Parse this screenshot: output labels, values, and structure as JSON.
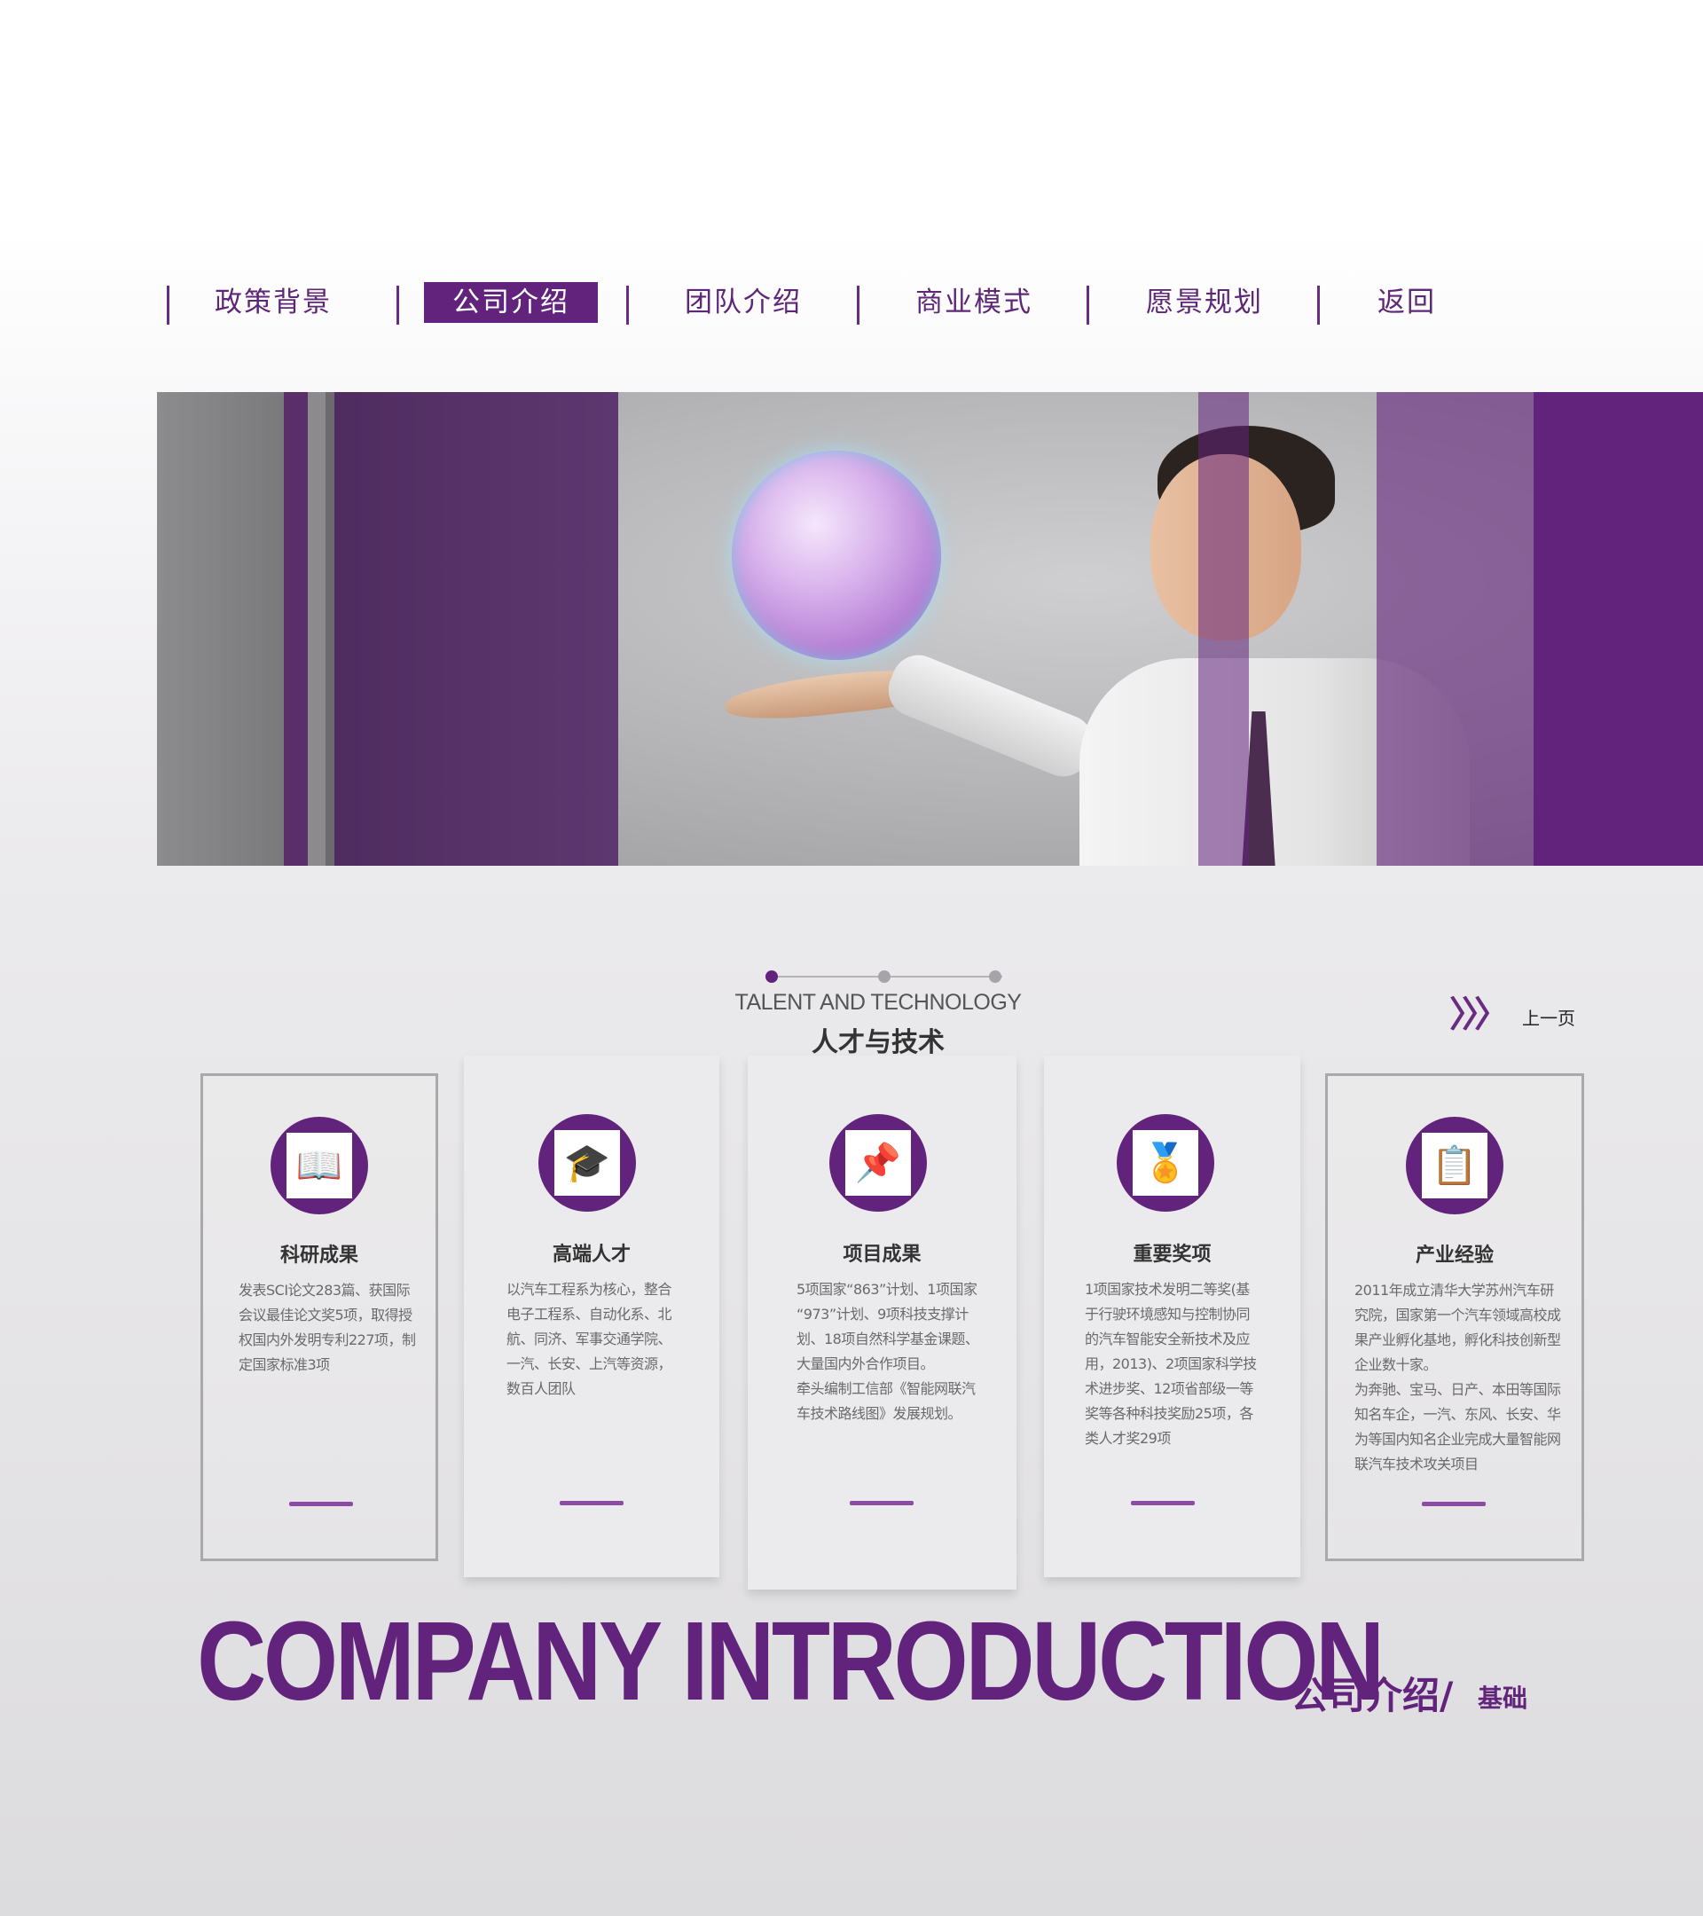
{
  "nav": {
    "items": [
      {
        "label": "政策背景",
        "active": false
      },
      {
        "label": "公司介绍",
        "active": true
      },
      {
        "label": "团队介绍",
        "active": false
      },
      {
        "label": "商业模式",
        "active": false
      },
      {
        "label": "愿景规划",
        "active": false
      },
      {
        "label": "返回",
        "active": false
      }
    ]
  },
  "section": {
    "title_en": "TALENT AND TECHNOLOGY",
    "title_cn": "人才与技术",
    "prev_label": "上一页",
    "prev_icon": "triple-chevron-right-icon"
  },
  "cards": [
    {
      "title": "科研成果",
      "icon": "open-book-icon",
      "text": "发表SCI论文283篇、获国际\n会议最佳论文奖5项，取得授\n权国内外发明专利227项，制\n定国家标准3项"
    },
    {
      "title": "高端人才",
      "icon": "graduate-cap-icon",
      "text": "以汽车工程系为核心，整合\n电子工程系、自动化系、北\n航、同济、军事交通学院、\n一汽、长安、上汽等资源，\n数百人团队"
    },
    {
      "title": "项目成果",
      "icon": "pushpin-icon",
      "text": "5项国家“863”计划、1项国家\n“973”计划、9项科技支撑计\n划、18项自然科学基金课题、\n大量国内外合作项目。\n牵头编制工信部《智能网联汽\n车技术路线图》发展规划。"
    },
    {
      "title": "重要奖项",
      "icon": "award-certificate-icon",
      "text": "1项国家技术发明二等奖(基\n于行驶环境感知与控制协同\n的汽车智能安全新技术及应\n用，2013)、2项国家科学技\n术进步奖、12项省部级一等\n奖等各种科技奖励25项，各\n类人才奖29项"
    },
    {
      "title": "产业经验",
      "icon": "clipboard-checklist-icon",
      "text": "2011年成立清华大学苏州汽车研\n究院，国家第一个汽车领域高校成\n果产业孵化基地，孵化科技创新型\n企业数十家。\n为奔驰、宝马、日产、本田等国际\n知名车企，一汽、东风、长安、华\n为等国内知名企业完成大量智能网\n联汽车技术攻关项目"
    }
  ],
  "bottom": {
    "title_en": "COMPANY INTRODUCTION",
    "title_cn": "公司介绍/",
    "subtitle_cn": "基础"
  },
  "colors": {
    "brand_purple": "#62237c",
    "accent_purple": "#8b4ca3",
    "text_gray": "#6a6a6a"
  }
}
